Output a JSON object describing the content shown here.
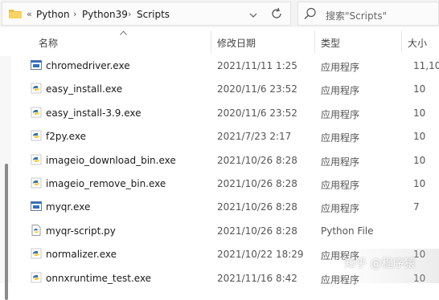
{
  "address_bar": {
    "breadcrumbs": [
      "Python",
      "Python39",
      "Scripts"
    ],
    "overflow_marker": "«",
    "separator": "›"
  },
  "search": {
    "placeholder": "搜索\"Scripts\""
  },
  "columns": {
    "name": "名称",
    "date": "修改日期",
    "type": "类型",
    "size": "大小"
  },
  "files": [
    {
      "name": "chromedriver.exe",
      "date": "2021/11/11 1:25",
      "type": "应用程序",
      "size": "11,10",
      "icon": "app-window-icon"
    },
    {
      "name": "easy_install.exe",
      "date": "2020/11/6 23:52",
      "type": "应用程序",
      "size": "10",
      "icon": "python-exe-icon"
    },
    {
      "name": "easy_install-3.9.exe",
      "date": "2020/11/6 23:52",
      "type": "应用程序",
      "size": "10",
      "icon": "python-exe-icon"
    },
    {
      "name": "f2py.exe",
      "date": "2021/7/23 2:17",
      "type": "应用程序",
      "size": "10",
      "icon": "python-exe-icon"
    },
    {
      "name": "imageio_download_bin.exe",
      "date": "2021/10/26 8:28",
      "type": "应用程序",
      "size": "10",
      "icon": "python-exe-icon"
    },
    {
      "name": "imageio_remove_bin.exe",
      "date": "2021/10/26 8:28",
      "type": "应用程序",
      "size": "10",
      "icon": "python-exe-icon"
    },
    {
      "name": "myqr.exe",
      "date": "2021/10/26 8:28",
      "type": "应用程序",
      "size": "7",
      "icon": "app-window-icon"
    },
    {
      "name": "myqr-script.py",
      "date": "2021/10/26 8:28",
      "type": "Python File",
      "size": "",
      "icon": "python-file-icon"
    },
    {
      "name": "normalizer.exe",
      "date": "2021/10/22 18:29",
      "type": "应用程序",
      "size": "10",
      "icon": "python-exe-icon"
    },
    {
      "name": "onnxruntime_test.exe",
      "date": "2021/11/16 8:42",
      "type": "应用程序",
      "size": "10",
      "icon": "python-exe-icon"
    }
  ],
  "watermark": "知乎 @程序猿"
}
